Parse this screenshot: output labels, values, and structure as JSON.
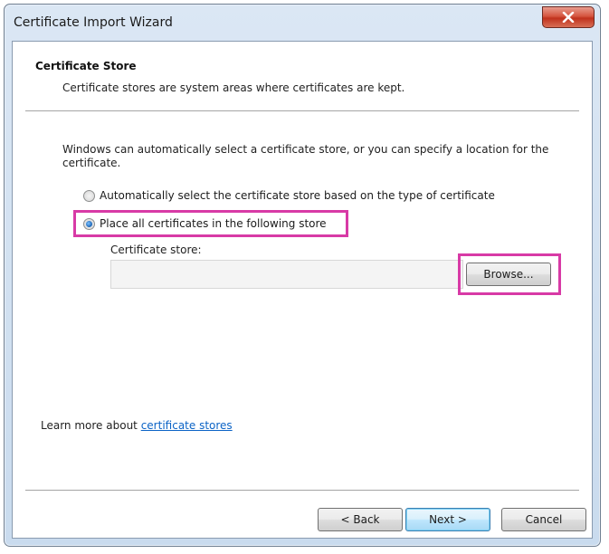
{
  "window": {
    "title": "Certificate Import Wizard"
  },
  "header": {
    "title": "Certificate Store",
    "description": "Certificate stores are system areas where certificates are kept."
  },
  "body": {
    "intro": "Windows can automatically select a certificate store, or you can specify a location for the certificate.",
    "options": [
      {
        "label": "Automatically select the certificate store based on the type of certificate",
        "selected": false
      },
      {
        "label": "Place all certificates in the following store",
        "selected": true
      }
    ],
    "store_label": "Certificate store:",
    "store_value": "",
    "browse_label": "Browse..."
  },
  "learn_more": {
    "prefix": "Learn more about ",
    "link_text": "certificate stores"
  },
  "footer": {
    "back_label": "< Back",
    "next_label": "Next >",
    "cancel_label": "Cancel"
  },
  "colors": {
    "highlight": "#d83aa6",
    "link": "#0b63c6",
    "close_button": "#c0321d"
  }
}
